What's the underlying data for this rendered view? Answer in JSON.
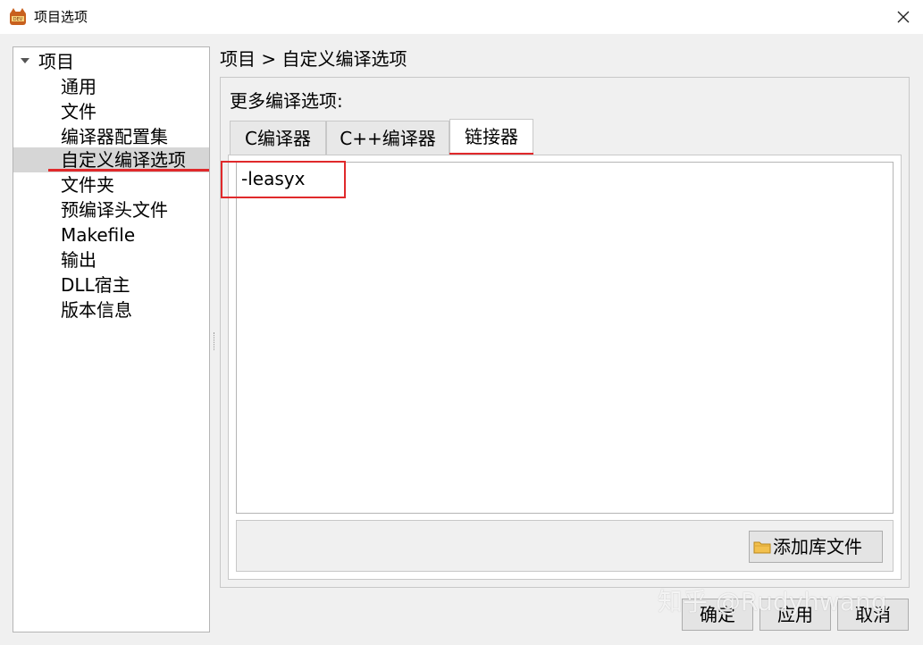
{
  "window": {
    "title": "项目选项",
    "close_label": "×"
  },
  "tree": {
    "root_label": "项目",
    "items": [
      {
        "label": "通用"
      },
      {
        "label": "文件"
      },
      {
        "label": "编译器配置集"
      },
      {
        "label": "自定义编译选项"
      },
      {
        "label": "文件夹"
      },
      {
        "label": "预编译头文件"
      },
      {
        "label": "Makefile"
      },
      {
        "label": "输出"
      },
      {
        "label": "DLL宿主"
      },
      {
        "label": "版本信息"
      }
    ]
  },
  "breadcrumb": "项目 > 自定义编译选项",
  "group": {
    "label": "更多编译选项:"
  },
  "tabs": [
    {
      "label": "C编译器"
    },
    {
      "label": "C++编译器"
    },
    {
      "label": "链接器"
    }
  ],
  "linker_options": {
    "value": "-leasyx"
  },
  "add_library_button": {
    "label": "添加库文件"
  },
  "buttons": {
    "ok": "确定",
    "apply": "应用",
    "cancel": "取消"
  },
  "watermark": "知乎 @Rudyhwang",
  "colors": {
    "highlight": "#e0292b",
    "selected_bg": "#d6d6d6"
  }
}
